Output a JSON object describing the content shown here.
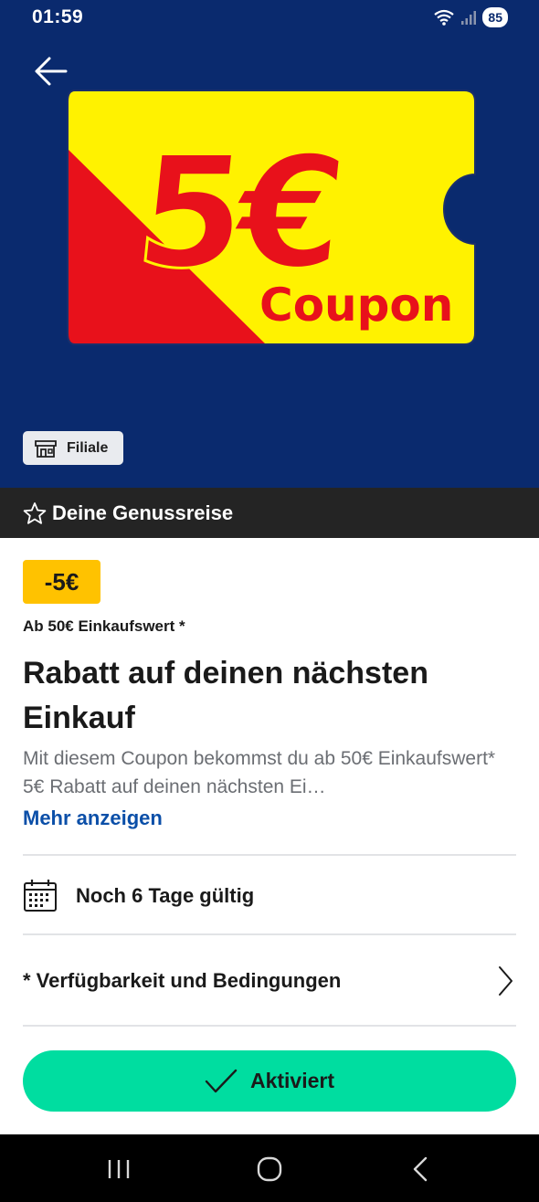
{
  "status_bar": {
    "time": "01:59",
    "battery": "85"
  },
  "hero": {
    "background_color": "#0a2a6e",
    "coupon_image": {
      "amount_text": "5€",
      "label_text": "Coupon",
      "colors": {
        "yellow": "#fff200",
        "red": "#e8111b"
      }
    },
    "store_chip_label": "Filiale"
  },
  "program_bar": {
    "label": "Deine Genussreise"
  },
  "offer": {
    "discount_badge": "-5€",
    "min_spend": "Ab 50€ Einkaufswert *",
    "title": "Rabatt auf deinen nächsten Einkauf",
    "description": "Mit diesem Coupon bekommst du ab 50€ Einkaufswert* 5€ Rabatt auf deinen nächsten Ei…",
    "more_link": "Mehr anzeigen"
  },
  "validity": {
    "icon": "calendar-icon",
    "label": "Noch 6 Tage gültig"
  },
  "conditions": {
    "label": "* Verfügbarkeit und Bedingungen",
    "icon": "chevron-right-icon"
  },
  "action_button": {
    "label": "Aktiviert",
    "icon": "checkmark-icon",
    "color": "#00dda0"
  },
  "nav_bar": {
    "buttons": [
      "recent-apps-icon",
      "home-icon",
      "back-icon"
    ]
  }
}
